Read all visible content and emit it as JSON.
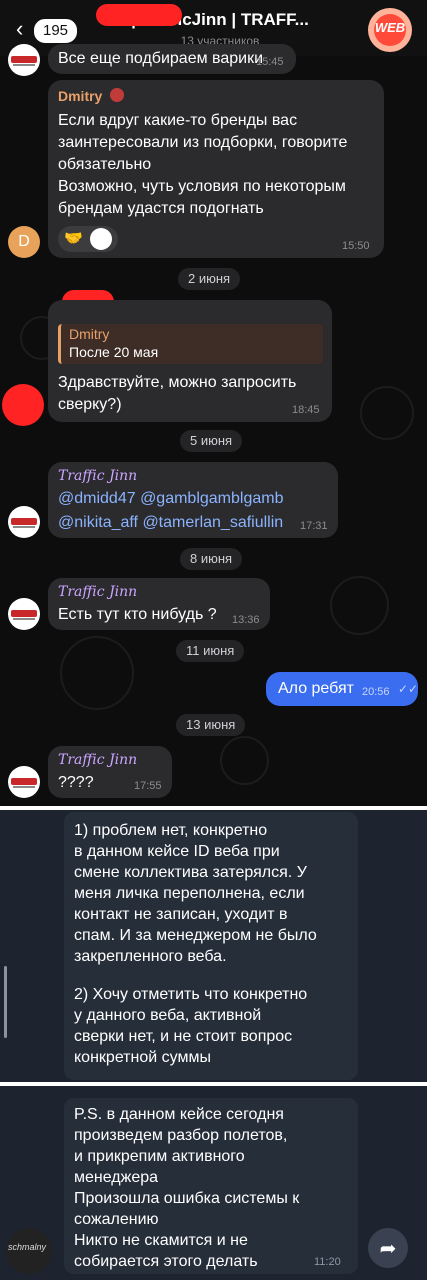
{
  "header": {
    "back_count": "195",
    "title": "| TrafficJinn | TRAFF...",
    "subtitle": "13 участников",
    "avatar_label": "WEB"
  },
  "messages": [
    {
      "text": "Все еще подбираем варики",
      "time": "15:45"
    },
    {
      "sender": "Dmitry",
      "lines": [
        "Если вдруг какие-то бренды вас",
        "заинтересовали из подборки, говорите",
        "обязательно",
        "Возможно, чуть условия по некоторым",
        "брендам удастся подогнать"
      ],
      "reaction": "🤝",
      "time": "15:50",
      "avatar_letter": "D"
    },
    {
      "reply_sender": "Dmitry",
      "reply_text": "После 20 мая",
      "lines": [
        "Здравствуйте, можно запросить",
        "сверку?)"
      ],
      "time": "18:45"
    },
    {
      "sender": "Traffic Jinn",
      "lines": [
        "@dmidd47 @gamblgamblgamb",
        "@nikita_aff @tamerlan_safiullin"
      ],
      "time": "17:31"
    },
    {
      "sender": "Traffic Jinn",
      "text": "Есть тут кто нибудь ?",
      "time": "13:36"
    },
    {
      "text": "Ало ребят",
      "time": "20:56"
    },
    {
      "sender": "Traffic Jinn",
      "text": "????",
      "time": "17:55"
    }
  ],
  "dates": [
    "2 июня",
    "5 июня",
    "8 июня",
    "11 июня",
    "13 июня"
  ],
  "section2": {
    "lines": [
      "1) проблем нет, конкретно",
      "в данном кейсе ID веба при",
      "смене коллектива затерялся. У",
      "меня личка переполнена, если",
      "контакт не записан, уходит в",
      "спам. И за менеджером не было",
      "закрепленного веба.",
      "",
      "2) Хочу отметить что конкретно",
      "у данного веба, активной",
      "сверки нет, и не стоит вопрос",
      "конкретной суммы"
    ]
  },
  "section3": {
    "lines": [
      "P.S. в данном кейсе сегодня",
      "произведем разбор полетов,",
      "и прикрепим активного",
      "менеджера",
      "Произошла ошибка системы к",
      "сожалению",
      "Никто не скамится и не",
      "собирается этого делать"
    ],
    "time": "11:20",
    "avatar_label": "schmalny"
  },
  "colors": {
    "accent_blue": "#3a6df0",
    "bubble": "#2b2a2c",
    "redaction": "#ff2323"
  }
}
